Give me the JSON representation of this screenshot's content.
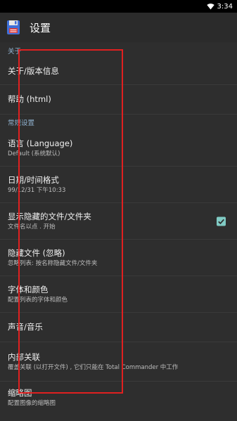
{
  "status_bar": {
    "time": "3:34",
    "icon": "wifi-icon"
  },
  "toolbar": {
    "title": "设置",
    "icon": "floppy-disk-icon"
  },
  "sections": {
    "about": "关于",
    "general": "常规设置"
  },
  "items": {
    "about_version": {
      "title": "关于/版本信息"
    },
    "help": {
      "title": "帮助 (html)"
    },
    "language": {
      "title": "语言 (Language)",
      "subtitle": "Default (系统默认)"
    },
    "datetime": {
      "title": "日期/时间格式",
      "subtitle": "99/12/31  下午10:33"
    },
    "hidden_files": {
      "title": "显示隐藏的文件/文件夹",
      "subtitle": "文件名以点 . 开始",
      "checked": true
    },
    "ignore_files": {
      "title": "隐藏文件 (忽略)",
      "subtitle": "忽略列表: 按名称隐藏文件/文件夹"
    },
    "fonts_colors": {
      "title": "字体和颜色",
      "subtitle": "配置列表的字体和颜色"
    },
    "sound": {
      "title": "声音/音乐"
    },
    "internal_assoc": {
      "title": "内部关联",
      "subtitle": "覆盖关联 (以打开文件) , 它们只能在 Total Commander 中工作"
    },
    "thumbnails": {
      "title": "缩略图",
      "subtitle": "配置图像的缩略图"
    }
  },
  "colors": {
    "background": "#2e2e2e",
    "section_header": "#8fb1cf",
    "checkbox_accent": "#80cbc4",
    "highlight_box": "#e02020"
  }
}
